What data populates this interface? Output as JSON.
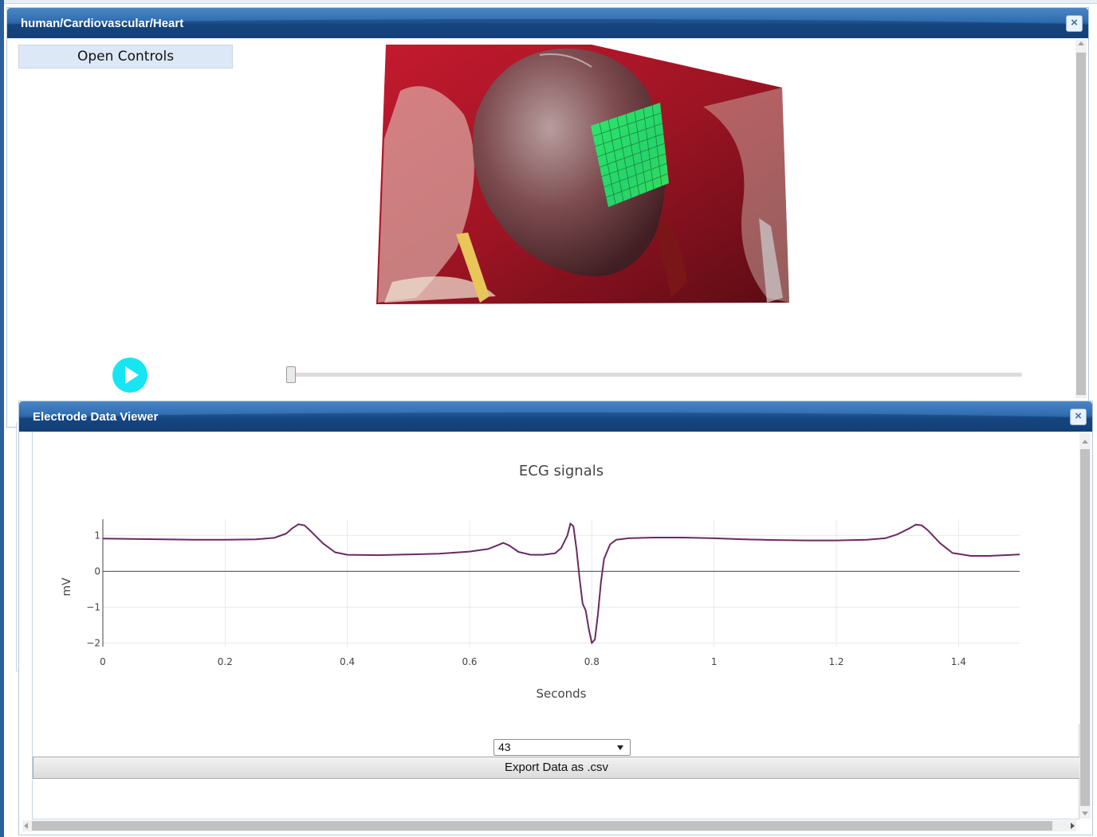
{
  "main_window": {
    "title": "human/Cardiovascular/Heart",
    "close_label": "×",
    "open_controls_label": "Open Controls",
    "playback_progress": 0
  },
  "viewer_window": {
    "title": "Electrode Data Viewer",
    "close_label": "×",
    "electrode_select_value": "43",
    "export_label": "Export Data as .csv"
  },
  "colors": {
    "titlebar": "#1f5596",
    "play_button": "#17e6f2",
    "electrode_grid": "#2ee86a",
    "trace": "#6b2a62"
  },
  "chart_data": {
    "type": "line",
    "title": "ECG signals",
    "xlabel": "Seconds",
    "ylabel": "mV",
    "xlim": [
      0,
      1.5
    ],
    "ylim": [
      -2.1,
      1.45
    ],
    "x_ticks": [
      "0",
      "0.2",
      "0.4",
      "0.6",
      "0.8",
      "1",
      "1.2",
      "1.4"
    ],
    "y_ticks": [
      "1",
      "0",
      "−1",
      "−2"
    ],
    "grid": true,
    "series": [
      {
        "x": [
          0,
          0.05,
          0.1,
          0.15,
          0.2,
          0.25,
          0.28,
          0.3,
          0.31,
          0.32,
          0.33,
          0.34,
          0.36,
          0.38,
          0.4,
          0.45,
          0.5,
          0.55,
          0.6,
          0.63,
          0.645,
          0.655,
          0.665,
          0.68,
          0.7,
          0.72,
          0.74,
          0.75,
          0.76,
          0.765,
          0.77,
          0.775,
          0.78,
          0.785,
          0.79,
          0.795,
          0.8,
          0.805,
          0.81,
          0.815,
          0.82,
          0.83,
          0.84,
          0.86,
          0.9,
          0.95,
          1.0,
          1.05,
          1.1,
          1.15,
          1.2,
          1.25,
          1.28,
          1.3,
          1.32,
          1.33,
          1.34,
          1.35,
          1.37,
          1.39,
          1.42,
          1.45,
          1.5
        ],
        "y": [
          0.91,
          0.9,
          0.89,
          0.88,
          0.88,
          0.89,
          0.93,
          1.05,
          1.2,
          1.31,
          1.28,
          1.12,
          0.78,
          0.53,
          0.46,
          0.45,
          0.47,
          0.49,
          0.55,
          0.62,
          0.72,
          0.79,
          0.72,
          0.54,
          0.46,
          0.46,
          0.5,
          0.65,
          1.0,
          1.33,
          1.25,
          0.6,
          -0.2,
          -0.9,
          -1.1,
          -1.6,
          -2.0,
          -1.9,
          -1.2,
          -0.3,
          0.35,
          0.75,
          0.88,
          0.92,
          0.94,
          0.94,
          0.92,
          0.89,
          0.87,
          0.86,
          0.86,
          0.88,
          0.92,
          1.03,
          1.2,
          1.3,
          1.28,
          1.14,
          0.78,
          0.51,
          0.43,
          0.43,
          0.47
        ]
      }
    ]
  }
}
